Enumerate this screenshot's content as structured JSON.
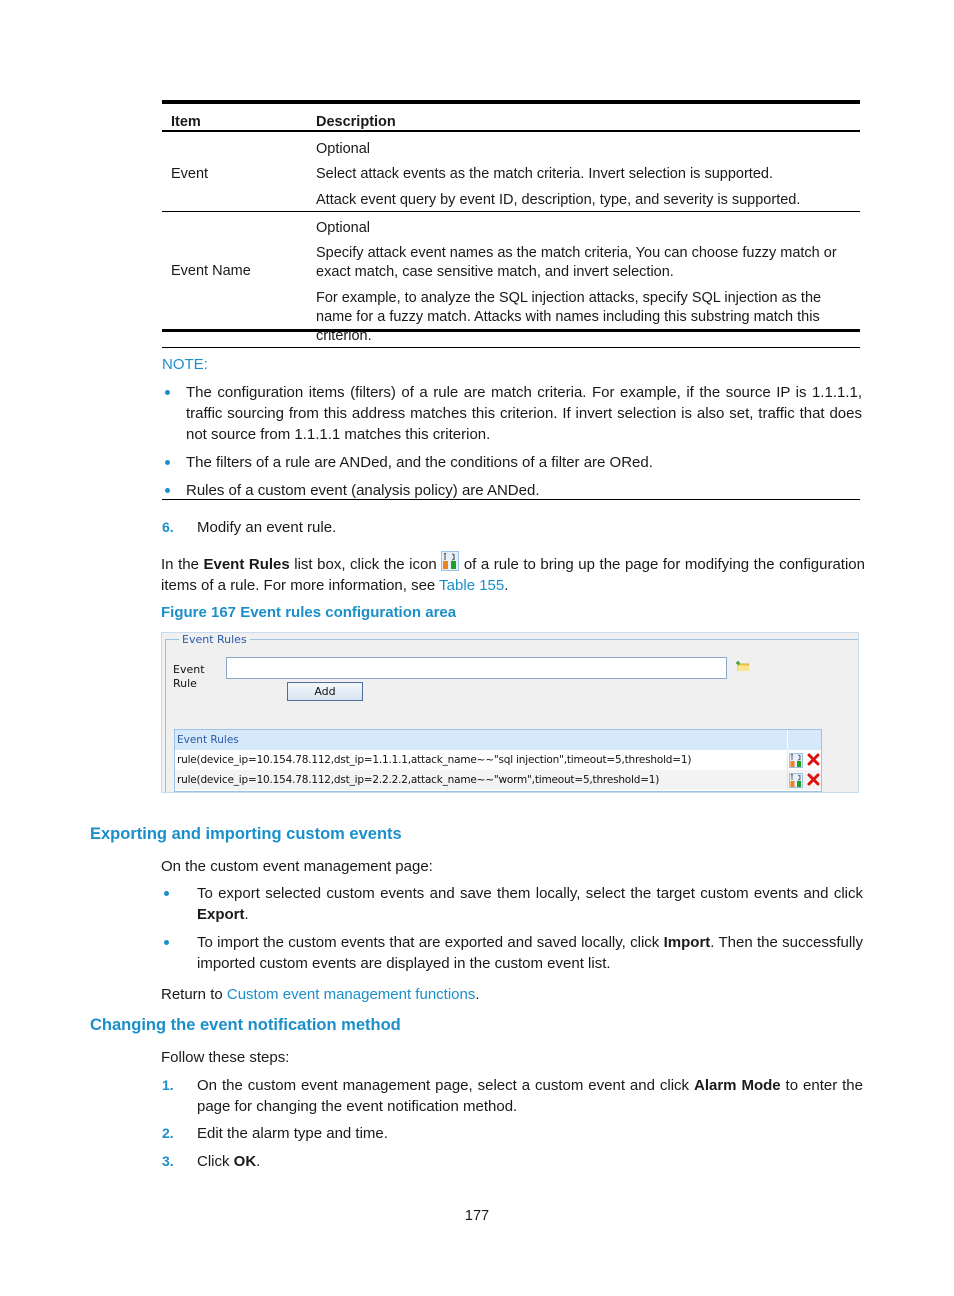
{
  "table": {
    "headers": {
      "item": "Item",
      "description": "Description"
    },
    "rows": [
      {
        "item": "Event",
        "description": [
          "Optional",
          "Select attack events as the match criteria. Invert selection is supported.",
          "Attack event query by event ID, description, type, and severity is supported."
        ]
      },
      {
        "item": "Event Name",
        "description": [
          "Optional",
          "Specify attack event names as the match criteria, You can choose fuzzy match or exact match, case sensitive match, and invert selection.",
          "For example, to analyze the SQL injection attacks, specify SQL injection as the name for a fuzzy match. Attacks with names including this substring match this criterion."
        ]
      }
    ]
  },
  "note": {
    "label": "NOTE:",
    "bullets": [
      "The configuration items (filters) of a rule are match criteria. For example, if the source IP is 1.1.1.1, traffic sourcing from this address matches this criterion. If invert selection is also set, traffic that does not source from 1.1.1.1 matches this criterion.",
      "The filters of a rule are ANDed, and the conditions of a filter are ORed.",
      "Rules of a custom event (analysis policy) are ANDed."
    ]
  },
  "step6": {
    "number": "6.",
    "text": "Modify an event rule."
  },
  "modify_para": {
    "part1": "In the ",
    "bold": "Event Rules",
    "part2": " list box, click the icon ",
    "part3": " of a rule to bring up the page for modifying the configuration items of a rule. For more information, see ",
    "link": "Table 155",
    "part4": "."
  },
  "figure": {
    "caption": "Figure 167 Event rules configuration area",
    "legend": "Event Rules",
    "field_label_line1": "Event",
    "field_label_line2": "Rule",
    "input_value": "",
    "add_button": "Add",
    "list_header": "Event Rules",
    "rules": [
      "rule(device_ip=10.154.78.112,dst_ip=1.1.1.1,attack_name~~\"sql injection\",timeout=5,threshold=1)",
      "rule(device_ip=10.154.78.112,dst_ip=2.2.2.2,attack_name~~\"worm\",timeout=5,threshold=1)"
    ]
  },
  "export_section": {
    "heading": "Exporting and importing custom events",
    "intro": "On the custom event management page:",
    "bullet1_text": "To export selected custom events and save them locally, select the target custom events and click ",
    "bullet1_bold": "Export",
    "bullet1_end": ".",
    "bullet2_text": "To import the custom events that are exported and saved locally, click ",
    "bullet2_bold": "Import",
    "bullet2_end": ". Then the successfully imported custom events are displayed in the custom event list.",
    "return_text": "Return to ",
    "return_link": "Custom event management functions",
    "return_end": "."
  },
  "notify_section": {
    "heading": "Changing the event notification method",
    "intro": "Follow these steps:",
    "steps": [
      {
        "number": "1.",
        "text": "On the custom event management page, select a custom event and click ",
        "bold": "Alarm Mode",
        "end": " to enter the page for changing the event notification method."
      },
      {
        "number": "2.",
        "text": "Edit the alarm type and time.",
        "bold": "",
        "end": ""
      },
      {
        "number": "3.",
        "text": "Click ",
        "bold": "OK",
        "end": "."
      }
    ]
  },
  "page_number": "177",
  "colors": {
    "accent": "#1a8fc9",
    "list_header_bg": "#d6e9fb",
    "figure_bg": "#f0f0f0",
    "delete_red": "#e01010"
  }
}
